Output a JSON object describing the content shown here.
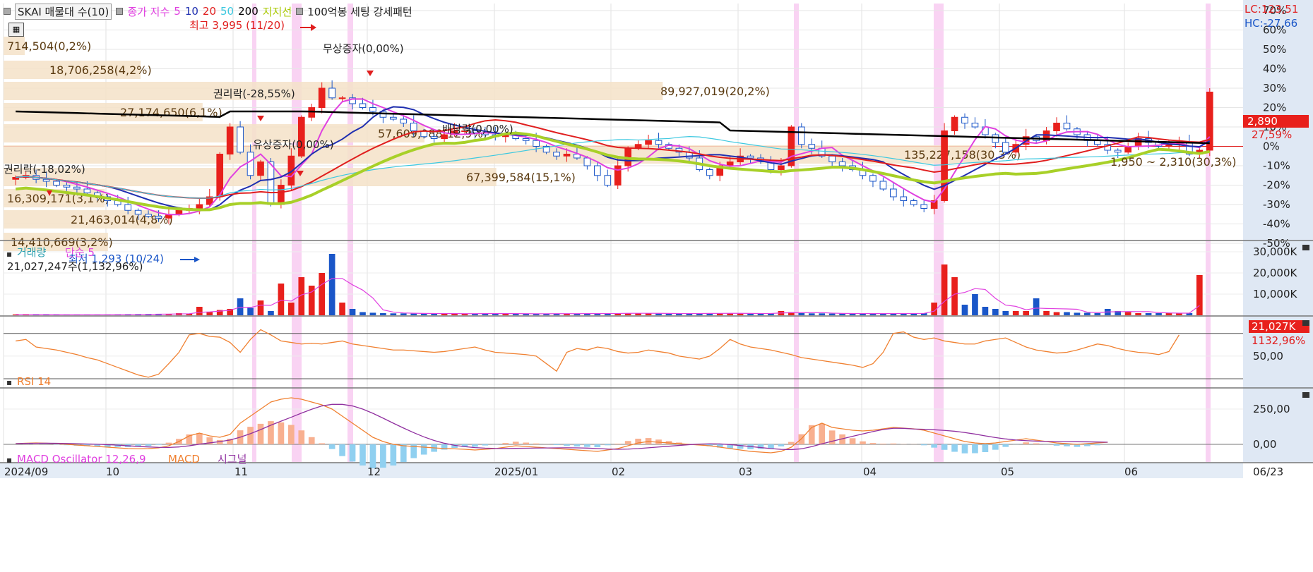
{
  "header": {
    "indicator_button": "SKAI 매물대 수(10)",
    "ma_label": "종가 지수",
    "ma_values": [
      "5",
      "10",
      "20",
      "50",
      "200"
    ],
    "support_label": "지지선",
    "setting_label": "100억봉 세팅 강세패턴",
    "lc": "LC:123,51",
    "hc": "HC:-27,66"
  },
  "colors": {
    "up": "#e8201c",
    "down": "#1a56c8",
    "ma5": "#e040e0",
    "ma10": "#1f2fb0",
    "ma20": "#e01e1e",
    "ma50": "#3cc8e0",
    "ma200": "#000000",
    "support": "#a8d028",
    "highlight": "#f8c8f0",
    "volume_box": "#f5e2c8",
    "rsi": "#f08030",
    "macd": "#f08030",
    "signal": "#9030a0",
    "osc_pos": "#f8b090",
    "osc_neg": "#90d0f0"
  },
  "price_axis": {
    "ticks": [
      "70%",
      "60%",
      "50%",
      "40%",
      "30%",
      "20%",
      "10%",
      "0%",
      "-10%",
      "-20%",
      "-30%",
      "-40%",
      "-50%"
    ],
    "current_price": "2,890",
    "current_change": "27,59%"
  },
  "volume_profile": [
    {
      "label": "714,504(0,2%)",
      "pct": 0.2
    },
    {
      "label": "18,706,258(4,2%)",
      "pct": 4.2
    },
    {
      "label": "27,174,650(6,1%)",
      "pct": 6.1
    },
    {
      "label": "89,927,019(20,2%)",
      "pct": 20.2
    },
    {
      "label": "57,609,088(12,9%)",
      "pct": 12.9
    },
    {
      "label": "135,227,158(30,3%)",
      "pct": 30.3
    },
    {
      "label": "67,399,584(15,1%)",
      "pct": 15.1
    },
    {
      "label": "16,309,171(3,1%)",
      "pct": 3.1
    },
    {
      "label": "21,463,014(4,8%)",
      "pct": 4.8
    },
    {
      "label": "14,410,669(3,2%)",
      "pct": 3.2
    }
  ],
  "price_range_label": "1,950 ~ 2,310(30,3%)",
  "annotations": {
    "high": "최고 3,995 (11/20)",
    "low": "최저 1,293 (10/24)",
    "rights1": "권리락(-18,02%)",
    "rights2": "권리락(-28,55%)",
    "paid": "유상증자(0,00%)",
    "bonus": "무상증자(0,00%)",
    "dividend": "배당락(0,00%)"
  },
  "volume_panel": {
    "title": "거래량",
    "ma_label": "단순 5",
    "summary": "21,027,247주(1,132,96%)",
    "ticks": [
      "30,000K",
      "20,000K",
      "10,000K"
    ],
    "current": "21,027K",
    "current_pct": "1132,96%"
  },
  "rsi_panel": {
    "title": "RSI 14",
    "tick": "50,00"
  },
  "macd_panel": {
    "title": "MACD Oscillator 12,26,9",
    "macd_label": "MACD",
    "signal_label": "시그널",
    "ticks": [
      "250,00",
      "0,00"
    ]
  },
  "x_axis": {
    "labels": [
      "2024/09",
      "10",
      "11",
      "12",
      "2025/01",
      "02",
      "03",
      "04",
      "05",
      "06",
      "06/23"
    ]
  },
  "chart_data": {
    "type": "candlestick",
    "yunit": "percent",
    "ylim": [
      -50,
      70
    ],
    "x": [
      "2024/09",
      "10",
      "11",
      "12",
      "2025/01",
      "02",
      "03",
      "04",
      "05",
      "06",
      "06/23"
    ],
    "price_series": {
      "close": [
        -16,
        -15,
        -17,
        -18,
        -20,
        -21,
        -22,
        -24,
        -26,
        -28,
        -30,
        -33,
        -35,
        -36,
        -37,
        -35,
        -33,
        -32,
        -30,
        -26,
        -4,
        10,
        -3,
        -15,
        -8,
        -30,
        -20,
        -5,
        15,
        20,
        30,
        25,
        25,
        22,
        20,
        18,
        15,
        14,
        12,
        8,
        5,
        4,
        6,
        8,
        8,
        7,
        6,
        5,
        6,
        4,
        3,
        0,
        -3,
        -5,
        -4,
        -6,
        -10,
        -15,
        -20,
        -10,
        -1,
        1,
        3,
        1,
        -1,
        -3,
        -6,
        -12,
        -15,
        -10,
        -8,
        -5,
        -6,
        -8,
        -12,
        -10,
        10,
        1,
        -1,
        -5,
        -8,
        -10,
        -12,
        -15,
        -18,
        -22,
        -26,
        -28,
        -30,
        -32,
        -28,
        8,
        15,
        12,
        10,
        6,
        2,
        -3,
        1,
        5,
        3,
        8,
        12,
        9,
        6,
        3,
        1,
        -2,
        -3,
        0,
        4,
        2,
        0,
        1,
        2,
        -4,
        -2,
        28
      ]
    },
    "volume_series": {
      "values": [
        0.4,
        0.3,
        0.3,
        0.3,
        0.2,
        0.2,
        0.2,
        0.3,
        0.3,
        0.3,
        0.4,
        0.5,
        0.5,
        0.5,
        0.6,
        0.6,
        1.0,
        0.8,
        4.0,
        1.5,
        2.5,
        3.0,
        8.0,
        3.5,
        7.0,
        2.0,
        15.0,
        6.0,
        18.0,
        14.0,
        20.0,
        29.0,
        6.0,
        3.0,
        1.5,
        1.2,
        1.0,
        0.9,
        0.9,
        0.8,
        0.8,
        0.8,
        0.8,
        0.7,
        0.7,
        0.8,
        0.9,
        0.8,
        0.7,
        0.7,
        0.7,
        0.7,
        0.8,
        0.8,
        0.8,
        0.7,
        0.8,
        0.9,
        0.9,
        1.0,
        1.0,
        0.9,
        0.9,
        0.8,
        0.8,
        0.8,
        0.8,
        1.0,
        1.0,
        0.9,
        0.9,
        0.8,
        0.8,
        0.9,
        0.9,
        2.0,
        1.5,
        1.0,
        0.9,
        0.9,
        0.8,
        0.8,
        0.8,
        0.8,
        0.8,
        0.8,
        0.9,
        0.9,
        0.9,
        1.0,
        6.0,
        24.0,
        18.0,
        5.0,
        10.0,
        4.0,
        3.0,
        2.0,
        2.0,
        2.0,
        8.0,
        2.0,
        1.5,
        1.5,
        1.2,
        1.2,
        1.0,
        3.0,
        2.0,
        1.5,
        1.0,
        1.0,
        1.0,
        1.0,
        1.0,
        1.0,
        19.0
      ]
    },
    "rsi_series": {
      "values": [
        70,
        72,
        62,
        60,
        58,
        55,
        52,
        48,
        45,
        40,
        35,
        30,
        25,
        22,
        26,
        40,
        55,
        78,
        80,
        76,
        75,
        68,
        55,
        72,
        85,
        78,
        70,
        68,
        66,
        67,
        66,
        68,
        70,
        66,
        64,
        62,
        60,
        58,
        58,
        57,
        56,
        55,
        56,
        58,
        60,
        62,
        58,
        55,
        54,
        53,
        52,
        50,
        40,
        30,
        55,
        60,
        58,
        62,
        60,
        56,
        54,
        55,
        58,
        56,
        54,
        50,
        48,
        46,
        50,
        60,
        72,
        66,
        62,
        60,
        58,
        55,
        52,
        48,
        46,
        44,
        42,
        40,
        38,
        35,
        40,
        55,
        80,
        82,
        75,
        72,
        74,
        70,
        68,
        66,
        66,
        70,
        72,
        74,
        68,
        62,
        58,
        56,
        54,
        55,
        58,
        62,
        66,
        64,
        60,
        57,
        55,
        54,
        52,
        56,
        78
      ]
    },
    "macd_series": {
      "macd": [
        5,
        8,
        10,
        8,
        5,
        0,
        -5,
        -10,
        -15,
        -20,
        -25,
        -30,
        -32,
        -30,
        -25,
        -10,
        20,
        60,
        80,
        60,
        50,
        70,
        150,
        200,
        250,
        300,
        320,
        330,
        320,
        300,
        280,
        250,
        200,
        150,
        100,
        50,
        20,
        0,
        -10,
        -15,
        -20,
        -25,
        -30,
        -32,
        -35,
        -40,
        -35,
        -30,
        -20,
        -10,
        -15,
        -20,
        -25,
        -30,
        -35,
        -40,
        -45,
        -50,
        -40,
        -30,
        -10,
        10,
        20,
        15,
        10,
        5,
        0,
        -5,
        -10,
        -20,
        -30,
        -40,
        -50,
        -55,
        -60,
        -50,
        -20,
        40,
        120,
        150,
        120,
        110,
        100,
        95,
        100,
        110,
        120,
        115,
        110,
        100,
        80,
        60,
        40,
        20,
        10,
        5,
        10,
        20,
        30,
        40,
        30,
        20,
        10,
        5,
        0,
        5,
        10,
        15
      ]
    }
  }
}
